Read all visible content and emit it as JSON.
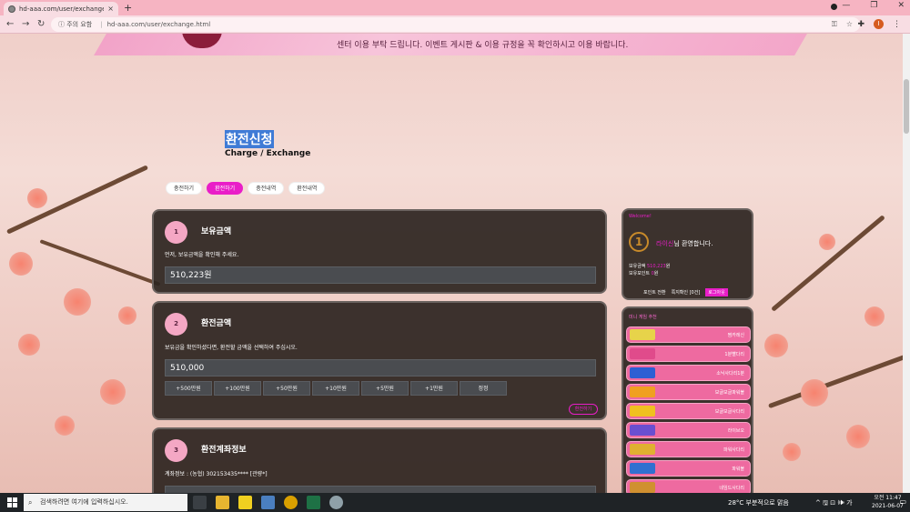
{
  "browser": {
    "tab_title": "hd-aaa.com/user/exchange.html",
    "close_glyph": "×",
    "new_tab_glyph": "+",
    "security_warning": "ⓘ 주의 요함",
    "url": "hd-aaa.com/user/exchange.html",
    "profile_initial": "I"
  },
  "banner": {
    "notice": "센터 이용 부탁 드립니다. 이벤트 게시판 & 이용 규정을 꼭 확인하시고 이용 바랍니다."
  },
  "heading": {
    "title_kr": "환전신청",
    "title_en": "Charge / Exchange"
  },
  "tabs": [
    {
      "label": "충전하기"
    },
    {
      "label": "환전하기"
    },
    {
      "label": "충전내역"
    },
    {
      "label": "환전내역"
    }
  ],
  "section1": {
    "number": "1",
    "title": "보유금액",
    "desc": "먼저, 보유금액을 확인해 주세요.",
    "value": "510,223원"
  },
  "section2": {
    "number": "2",
    "title": "환전금액",
    "desc": "보유금을 확인하셨다면, 환전할 금액을 선택하여 주십시오.",
    "value": "510,000",
    "buttons": [
      "+500만원",
      "+100만원",
      "+50만원",
      "+10만원",
      "+5만원",
      "+1만원",
      "정정"
    ],
    "apply_label": "환전하기"
  },
  "section3": {
    "number": "3",
    "title": "환전계좌정보",
    "desc": "계좌정보 : (농협) 302153435**** [관량*]"
  },
  "welcome": {
    "label": "Welcome!",
    "level": "1",
    "nickname": "라이신",
    "greeting_suffix": "님 환영합니다.",
    "balance_label": "보유금액",
    "balance_value": "510,223",
    "balance_unit": "원",
    "points_label": "보유포인트",
    "points_value": "0",
    "points_unit": "원",
    "btn_points": "포인트 전환",
    "btn_messages": "쪽지확인 [0건]",
    "btn_logout": "로그아웃"
  },
  "games": {
    "title": "미니 게임 추천",
    "items": [
      {
        "name": "찜카레신",
        "color": "#e7d34a"
      },
      {
        "name": "1분빨다리",
        "color": "#e04b8b"
      },
      {
        "name": "소닉사다리1분",
        "color": "#2d5fd3"
      },
      {
        "name": "보글보글파워볼",
        "color": "#f0a020"
      },
      {
        "name": "보글보글사다리",
        "color": "#f0c020"
      },
      {
        "name": "라이브오",
        "color": "#6a4fd0"
      },
      {
        "name": "파워사다리",
        "color": "#e0b030"
      },
      {
        "name": "파워볼",
        "color": "#3070d0"
      },
      {
        "name": "네임드사다리",
        "color": "#d09030"
      }
    ]
  },
  "taskbar": {
    "search_placeholder": "검색하려면 여기에 입력하십시오.",
    "weather": "28°C  부분적으로 맑음",
    "tray": "^ 🖫 ⊡ 🕪 가",
    "time": "오전 11:47",
    "date": "2021-06-07"
  }
}
